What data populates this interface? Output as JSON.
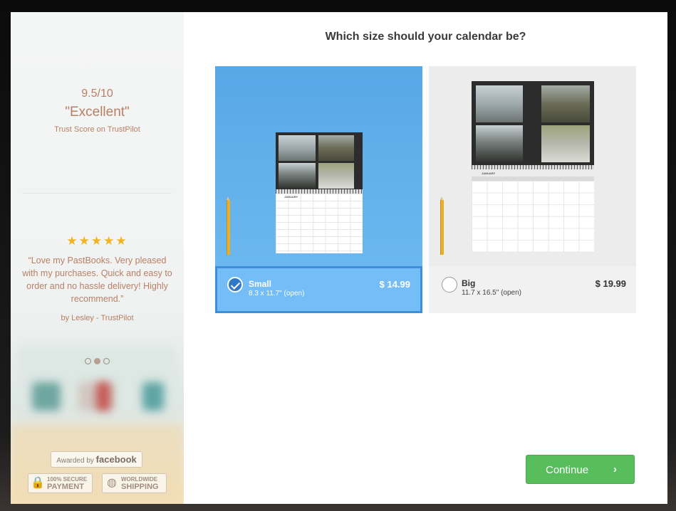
{
  "sidebar": {
    "score_value": "9.5/10",
    "score_word": "\"Excellent\"",
    "score_caption": "Trust Score on TrustPilot",
    "stars": "★★★★★",
    "review_text": "“Love my PastBooks. Very pleased with my purchases. Quick and easy to order and no hassle delivery! Highly recommend.”",
    "review_author": "by Lesley - TrustPilot",
    "carousel_active_index": 1,
    "fb_badge_prefix": "Awarded by",
    "fb_badge_brand": "facebook",
    "secure_line1": "100% SECURE",
    "secure_line2": "PAYMENT",
    "shipping_line1": "WORLDWIDE",
    "shipping_line2": "SHIPPING"
  },
  "main": {
    "title": "Which size should your calendar be?",
    "options": [
      {
        "name": "Small",
        "dimensions": "8.3 x 11.7\" (open)",
        "price": "$ 14.99",
        "selected": true
      },
      {
        "name": "Big",
        "dimensions": "11.7 x 16.5\" (open)",
        "price": "$ 19.99",
        "selected": false
      }
    ],
    "continue_label": "Continue",
    "continue_chevron": "›"
  },
  "colors": {
    "accent_blue": "#74bdf6",
    "selected_border": "#3f8fd8",
    "continue_green": "#58be5c",
    "sidebar_text": "#b87f64",
    "star_gold": "#f0b323"
  }
}
